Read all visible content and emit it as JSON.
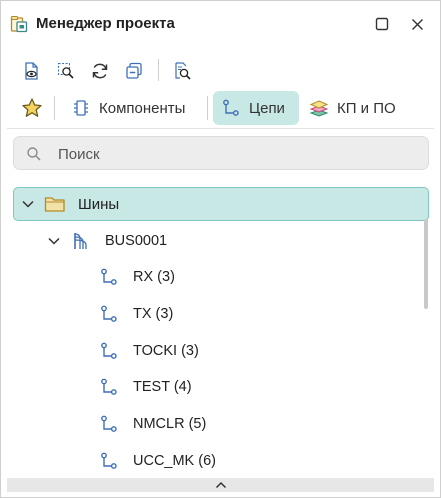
{
  "window": {
    "title": "Менеджер проекта",
    "title_icon": "project-manager-icon",
    "controls": [
      {
        "name": "maximize",
        "icon": "maximize-icon"
      },
      {
        "name": "close",
        "icon": "close-icon"
      }
    ]
  },
  "toolbar": {
    "buttons": [
      {
        "name": "preview",
        "icon": "document-eye-icon"
      },
      {
        "name": "zoom-select",
        "icon": "zoom-select-icon"
      },
      {
        "name": "refresh",
        "icon": "refresh-icon"
      },
      {
        "name": "collapse-all",
        "icon": "collapse-all-icon"
      },
      {
        "name": "find-in-document",
        "icon": "document-search-icon"
      }
    ]
  },
  "tabs": {
    "favorites_icon": "star-icon",
    "items": [
      {
        "label": "Компоненты",
        "icon": "component-icon",
        "active": false
      },
      {
        "label": "Цепи",
        "icon": "net-icon",
        "active": true
      },
      {
        "label": "КП и ПО",
        "icon": "layers-icon",
        "active": false
      }
    ]
  },
  "search": {
    "placeholder": "Поиск",
    "value": ""
  },
  "tree": {
    "group": {
      "label": "Шины",
      "expanded": true,
      "selected": true,
      "icon": "folder-icon"
    },
    "bus": {
      "label": "BUS0001",
      "expanded": true,
      "icon": "bus-icon"
    },
    "nets": [
      {
        "label": "RX (3)",
        "icon": "net-icon"
      },
      {
        "label": "TX (3)",
        "icon": "net-icon"
      },
      {
        "label": "TOCKI (3)",
        "icon": "net-icon"
      },
      {
        "label": "TEST (4)",
        "icon": "net-icon"
      },
      {
        "label": "NMCLR (5)",
        "icon": "net-icon"
      },
      {
        "label": "UCC_MK (6)",
        "icon": "net-icon"
      }
    ]
  },
  "colors": {
    "accent_bg": "#c8e8e6",
    "accent_border": "#7fc7c1",
    "icon_blue": "#3f6fb6",
    "folder_fill": "#f3e2a8",
    "folder_stroke": "#b58a24",
    "star_fill": "#f4d35e"
  }
}
